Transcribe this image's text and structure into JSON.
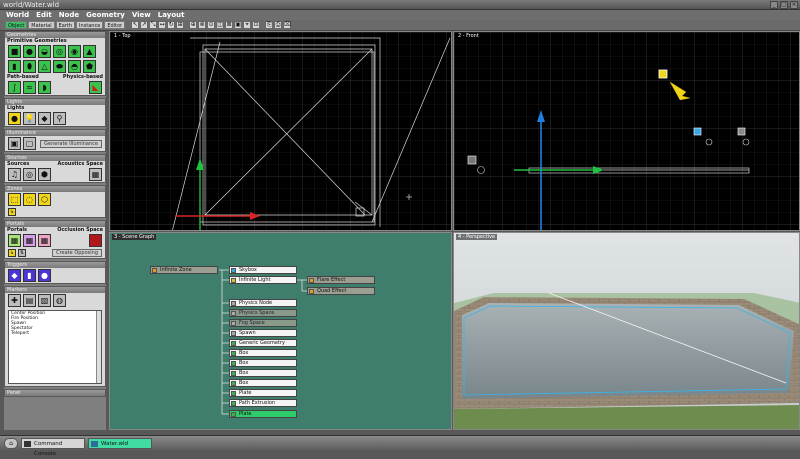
{
  "window": {
    "title": "world/Water.wld"
  },
  "menu": [
    "World",
    "Edit",
    "Node",
    "Geometry",
    "View",
    "Layout"
  ],
  "toolbar": {
    "tabs": [
      "Object",
      "Material",
      "Earth",
      "Instance",
      "Editor"
    ],
    "buttons1": [
      "↖",
      "↗",
      "⤡",
      "↔",
      "↻",
      "⊞"
    ],
    "buttons2": [
      "⊕",
      "⊗",
      "⊙",
      "◫",
      "⊠",
      "▣",
      "⌖",
      "⊡"
    ],
    "buttons3": [
      "⎘",
      "⎙",
      "⌧"
    ]
  },
  "sidebar": {
    "geometries": {
      "header": "Geometries",
      "primitives_label": "Primitive Geometries",
      "pathbased_label": "Path-based",
      "physicsbased_label": "Physics-based"
    },
    "lights": {
      "header": "Lights",
      "label": "Lights"
    },
    "illuminance": {
      "header": "Illuminance",
      "button": "Generate Illuminance"
    },
    "sources": {
      "header": "Sources",
      "sources_label": "Sources",
      "acoustics_label": "Acoustics Space"
    },
    "portals": {
      "header": "Portals",
      "portals_label": "Portals",
      "occlusion_label": "Occlusion Space",
      "button": "Create Opposing"
    },
    "triggers": {
      "header": "Triggers"
    },
    "markers": {
      "header": "Markers",
      "list": [
        "Center Position",
        "Fire Position",
        "Spawn",
        "Spectator",
        "Teleport"
      ]
    },
    "panel_last": {
      "header": "Panel"
    }
  },
  "viewports": {
    "top": "1 - Top",
    "front": "2 - Front",
    "graph": "3 - Scene Graph",
    "persp": "4 - Perspective"
  },
  "scene_graph": {
    "root": "Infinite Zone",
    "children": [
      "Skybox",
      "Infinite Light",
      "Physics Node",
      "Physics Space",
      "Fog Space",
      "Spawn",
      "Generic Geometry",
      "Box",
      "Box",
      "Box",
      "Box",
      "Plate",
      "Path Extrusion",
      "Plate"
    ],
    "light_children": [
      "Flare Effect",
      "Quad Effect"
    ]
  },
  "taskbar": {
    "start": "⌂",
    "items": [
      "Command Console",
      "Water.wld"
    ]
  }
}
